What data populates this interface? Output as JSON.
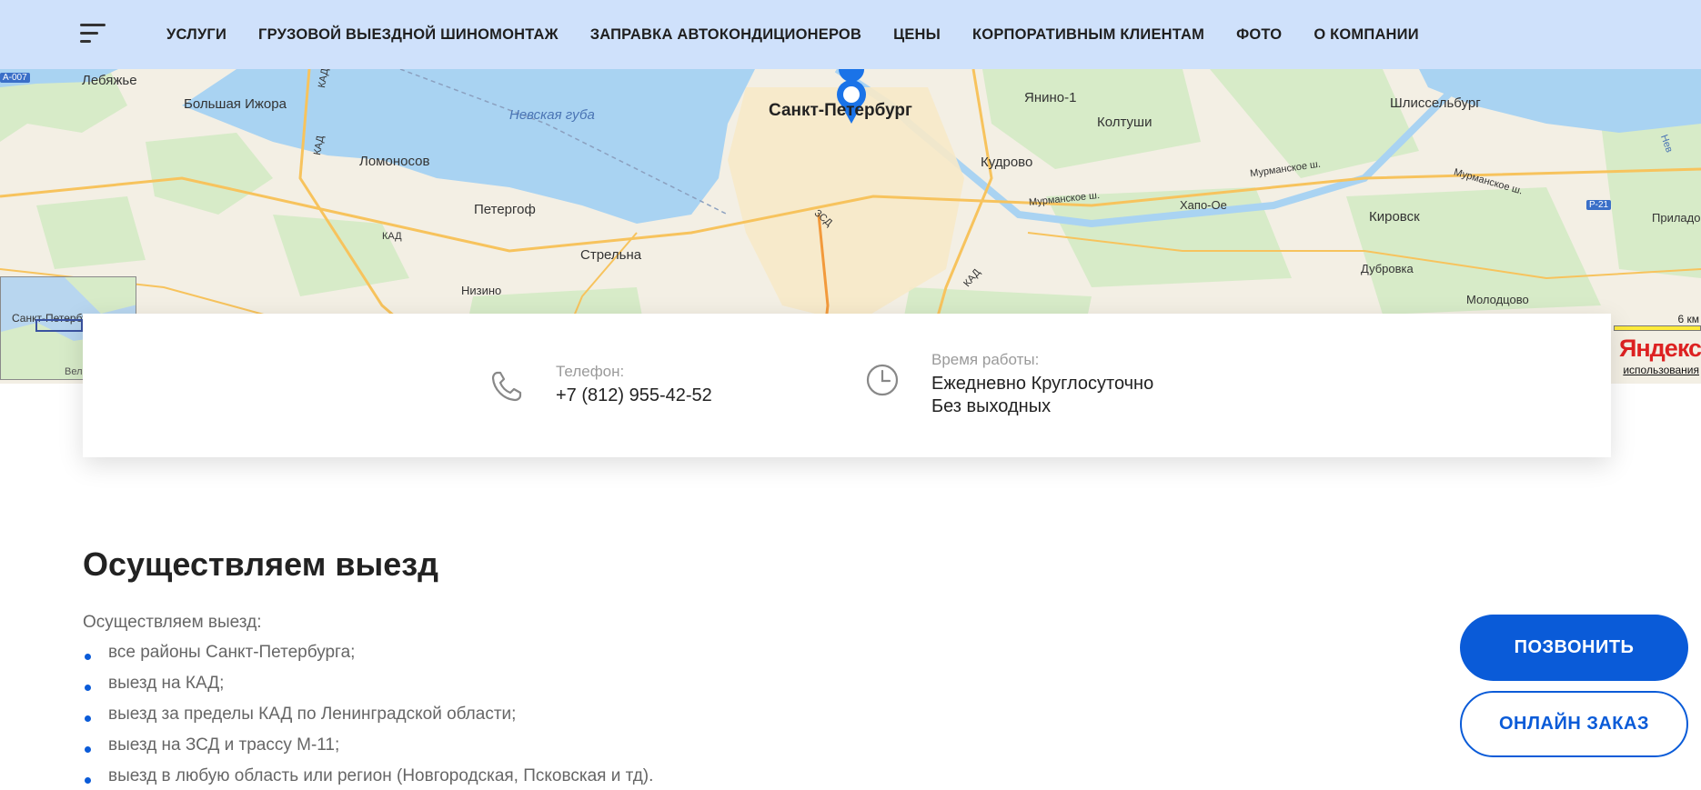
{
  "header": {
    "nav": [
      "УСЛУГИ",
      "ГРУЗОВОЙ ВЫЕЗДНОЙ ШИНОМОНТАЖ",
      "ЗАПРАВКА АВТОКОНДИЦИОНЕРОВ",
      "ЦЕНЫ",
      "КОРПОРАТИВНЫМ КЛИЕНТАМ",
      "ФОТО",
      "О КОМПАНИИ"
    ]
  },
  "map": {
    "labels": {
      "lebyazhye": "Лебяжье",
      "bolshaya_izhora": "Большая Ижора",
      "lomonosov": "Ломоносов",
      "peterhof": "Петергоф",
      "strelna": "Стрельна",
      "nizino": "Низино",
      "nevskaya_guba": "Невская губа",
      "spb": "Санкт-Петербург",
      "yanino": "Янино-1",
      "koltushi": "Колтуши",
      "kudrovo": "Кудрово",
      "shlisselburg": "Шлиссельбург",
      "kirovsk": "Кировск",
      "dubrovka": "Дубровка",
      "molodtsovo": "Молодцово",
      "prilad": "Приладо",
      "khapo_oe": "Хапо-Ое",
      "murm1": "Мурманское ш.",
      "murm2": "Мурманское ш.",
      "murm3": "Мурманское ш.",
      "kad1": "КАД",
      "kad2": "КАД",
      "kad3": "КАД",
      "zsd": "ЗСД",
      "a007": "А-007",
      "r21": "Р-21",
      "minimap_spb": "Санкт-Петербург",
      "minimap_vel": "Вел"
    },
    "scale": "6 км",
    "logo": "Яндекс",
    "terms": "использования"
  },
  "contacts": {
    "phone_label": "Телефон:",
    "phone_value": "+7 (812) 955-42-52",
    "hours_label": "Время работы:",
    "hours_line1": "Ежедневно Круглосуточно",
    "hours_line2": "Без выходных"
  },
  "content": {
    "title": "Осуществляем выезд",
    "intro": "Осуществляем выезд:",
    "items": [
      "все районы Санкт-Петербурга;",
      "выезд на КАД;",
      "выезд за пределы КАД по Ленинградской области;",
      "выезд на ЗСД и трассу М-11;",
      "выезд в любую область или регион (Новгородская, Псковская и тд)."
    ]
  },
  "buttons": {
    "call": "ПОЗВОНИТЬ",
    "order": "ОНЛАЙН ЗАКАЗ"
  },
  "colors": {
    "header_bg": "#cfe1fb",
    "accent": "#0a5bd8",
    "water": "#a9d3f2",
    "land": "#f3efe4",
    "forest": "#d7ebc8"
  },
  "icons": [
    "menu-icon",
    "phone-icon",
    "clock-icon",
    "map-pin-icon"
  ]
}
